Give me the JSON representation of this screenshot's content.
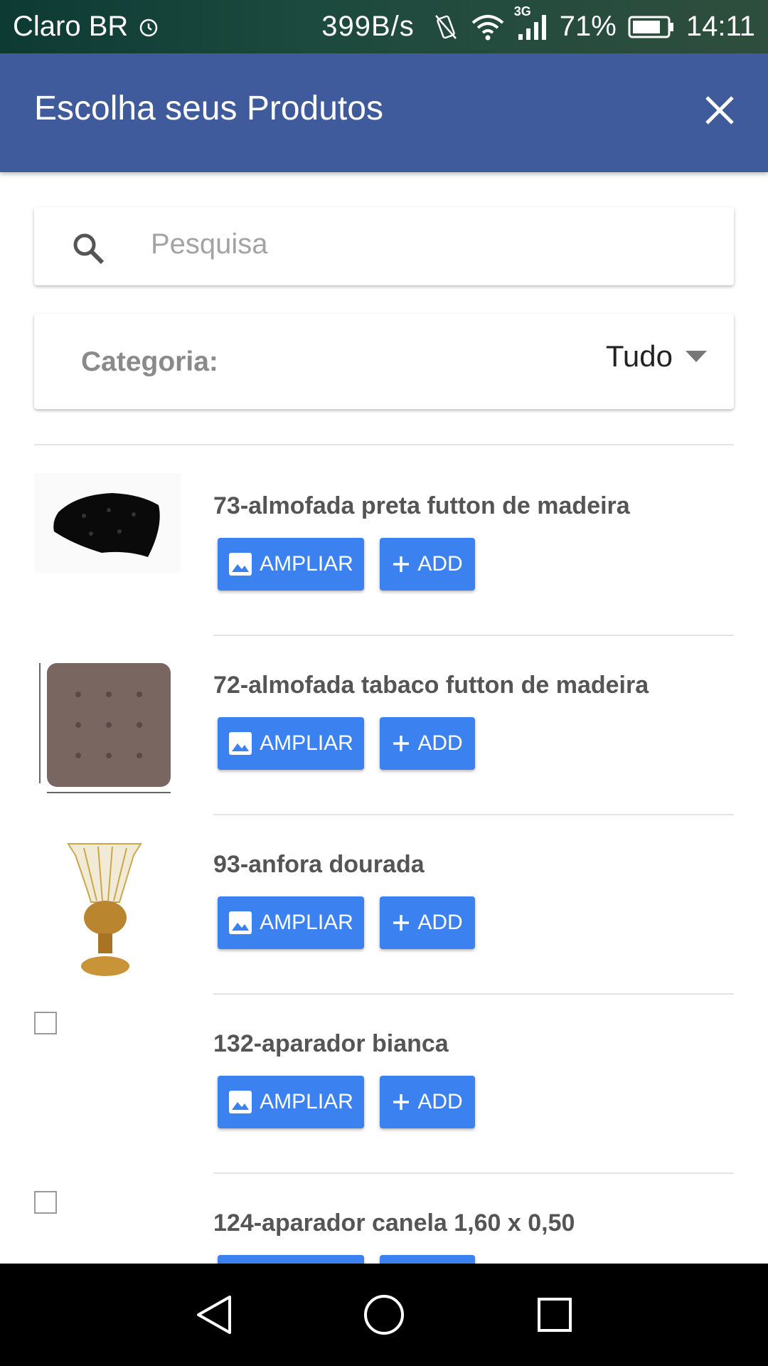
{
  "status_bar": {
    "carrier": "Claro BR",
    "speed": "399B/s",
    "network": "3G",
    "battery": "71%",
    "time": "14:11"
  },
  "header": {
    "title": "Escolha seus Produtos"
  },
  "search": {
    "placeholder": "Pesquisa",
    "value": ""
  },
  "category": {
    "label": "Categoria:",
    "selected": "Tudo"
  },
  "buttons": {
    "ampliar": "AMPLIAR",
    "add": "ADD"
  },
  "products": [
    {
      "name": "73-almofada preta futton de madeira",
      "image": "black-cushion"
    },
    {
      "name": "72-almofada tabaco futton de madeira",
      "image": "brown-cushion"
    },
    {
      "name": "93-anfora dourada",
      "image": "golden-vase"
    },
    {
      "name": "132-aparador bianca",
      "image": "missing-image"
    },
    {
      "name": "124-aparador canela 1,60 x 0,50",
      "image": "missing-image"
    }
  ],
  "colors": {
    "app_bar": "#3f5b9b",
    "button": "#3b82f0",
    "product_text": "#555555"
  }
}
